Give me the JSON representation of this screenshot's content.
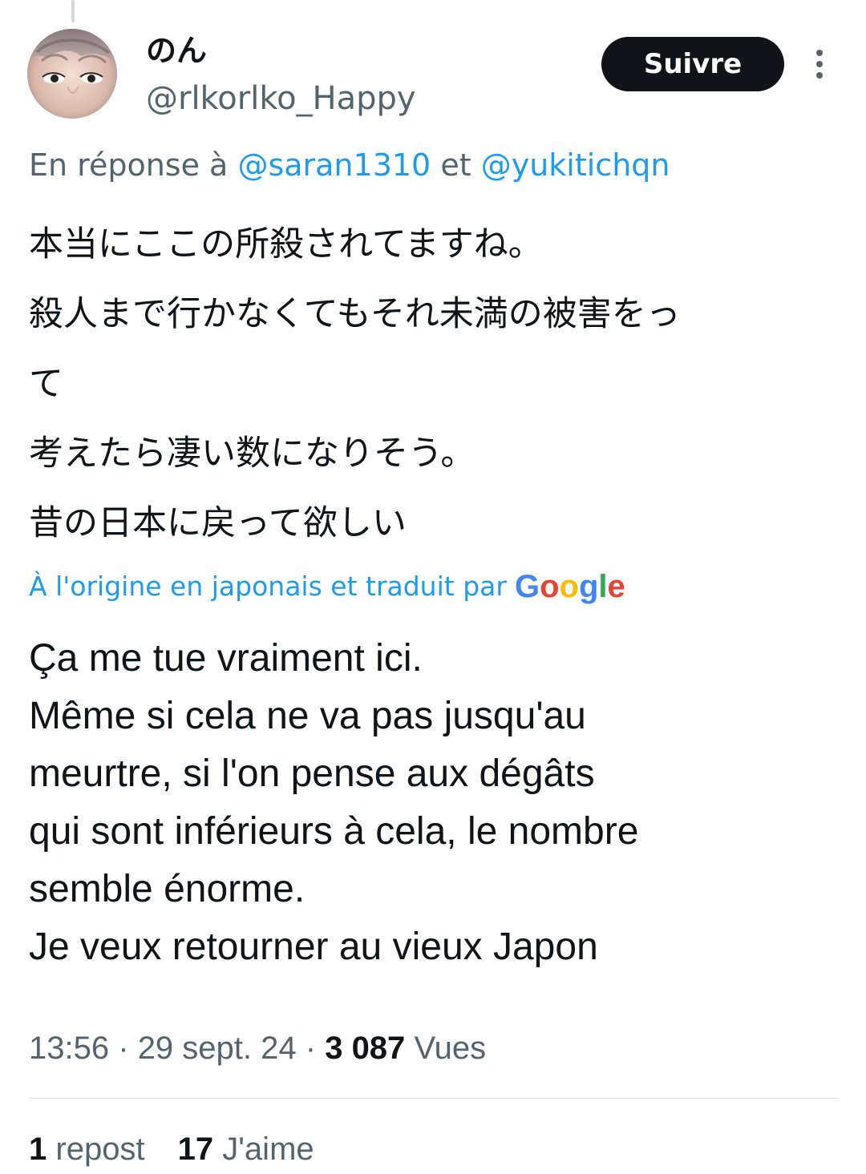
{
  "post": {
    "author": {
      "display_name": "のん",
      "handle": "@rlkorlko_Happy",
      "avatar": "profile-photo"
    },
    "follow_label": "Suivre",
    "more_icon": "more-vertical-icon",
    "reply": {
      "prefix": "En réponse à",
      "mention_1": "@saran1310",
      "joiner": "et",
      "mention_2": "@yukitichqn"
    },
    "original_lines": [
      "本当にここの所殺されてますね。",
      "殺人まで行かなくてもそれ未満の被害をっ",
      "て",
      "考えたら凄い数になりそう。",
      "昔の日本に戻って欲しい"
    ],
    "translation": {
      "source_label": "À l'origine en japonais et traduit par",
      "provider": "Google"
    },
    "translated_lines": [
      "Ça me tue vraiment ici.",
      "Même si cela ne va pas jusqu'au",
      "meurtre, si l'on pense aux dégâts",
      "qui sont inférieurs à cela, le nombre",
      "semble énorme.",
      "Je veux retourner au vieux Japon"
    ],
    "meta": {
      "time": "13:56",
      "separator": "·",
      "date": "29 sept. 24",
      "views_count": "3 087",
      "views_label": "Vues"
    },
    "stats": {
      "reposts_count": "1",
      "reposts_label": "repost",
      "likes_count": "17",
      "likes_label": "J'aime"
    }
  },
  "colors": {
    "text": "#0f1419",
    "secondary_text": "#536471",
    "link": "#1d9bf0",
    "button_bg": "#0f1419",
    "divider": "#dbe1e5",
    "google_blue": "#4285f4",
    "google_red": "#ea4335",
    "google_yellow": "#fbbc05",
    "google_green": "#34a853"
  }
}
